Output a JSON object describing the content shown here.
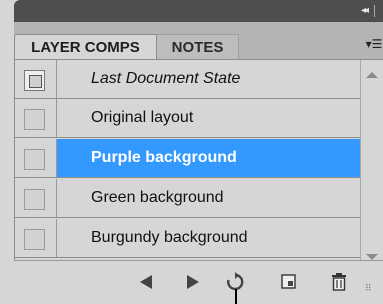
{
  "window": {
    "collapse_icon": "◂◂",
    "close_icon": "×"
  },
  "tabs": [
    {
      "label": "LAYER COMPS",
      "active": true
    },
    {
      "label": "NOTES",
      "active": false
    }
  ],
  "panel_menu_icon": "▾☰",
  "list": {
    "rows": [
      {
        "label": "Last Document State",
        "italic": true,
        "selected": false
      },
      {
        "label": "Original layout",
        "italic": false,
        "selected": false
      },
      {
        "label": "Purple background",
        "italic": false,
        "selected": true
      },
      {
        "label": "Green background",
        "italic": false,
        "selected": false
      },
      {
        "label": "Burgundy background",
        "italic": false,
        "selected": false
      }
    ]
  },
  "colors": {
    "panel_bg": "#d6d6d6",
    "title_bar": "#4e4e4e",
    "selection": "#3399ff",
    "tab_strip": "#b4b4b4"
  },
  "toolbar": {
    "buttons": [
      {
        "name": "previous-comp",
        "icon": "left-triangle-icon"
      },
      {
        "name": "next-comp",
        "icon": "right-triangle-icon"
      },
      {
        "name": "update-comp",
        "icon": "refresh-icon"
      },
      {
        "name": "new-comp",
        "icon": "new-page-icon"
      },
      {
        "name": "delete-comp",
        "icon": "trash-icon"
      }
    ]
  }
}
